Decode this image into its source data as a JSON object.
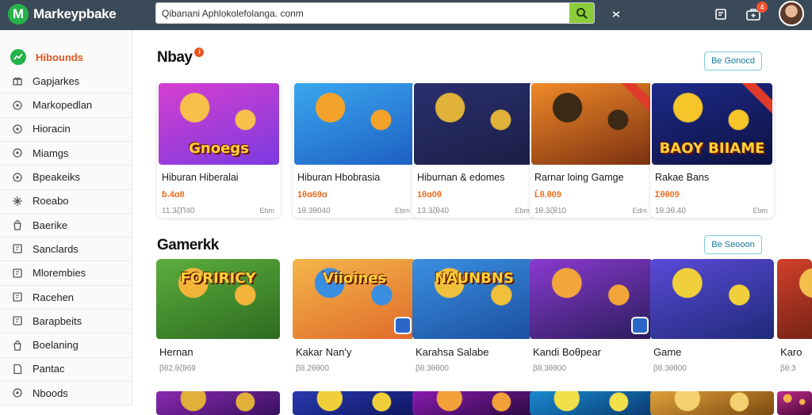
{
  "app": {
    "name": "Markeypbake",
    "logo_letter": "M"
  },
  "search": {
    "value": "Qibanani Aphlokolefolanga. conm",
    "placeholder": ""
  },
  "toolbar": {
    "cart_badge": "4"
  },
  "sidebar": {
    "items": [
      {
        "label": "Hibounds",
        "icon": "trend-icon"
      },
      {
        "label": "Gapjarkes",
        "icon": "gift-icon"
      },
      {
        "label": "Markopedlan",
        "icon": "circle-icon"
      },
      {
        "label": "Hioracin",
        "icon": "circle-icon"
      },
      {
        "label": "Miamgs",
        "icon": "circle-icon"
      },
      {
        "label": "Bpeakeiks",
        "icon": "circle-icon"
      },
      {
        "label": "Roeabo",
        "icon": "star-icon"
      },
      {
        "label": "Baerike",
        "icon": "bag-icon"
      },
      {
        "label": "Sanclards",
        "icon": "square-icon"
      },
      {
        "label": "Mlorembies",
        "icon": "square-icon"
      },
      {
        "label": "Racehen",
        "icon": "square-icon"
      },
      {
        "label": "Barapbeits",
        "icon": "square-icon"
      },
      {
        "label": "Boelaning",
        "icon": "bag-icon"
      },
      {
        "label": "Pantac",
        "icon": "page-icon"
      },
      {
        "label": "Nboods",
        "icon": "circle-icon"
      }
    ]
  },
  "sections": [
    {
      "title": "Nbay",
      "see_all": "Be Gonocd",
      "cards": [
        {
          "title": "Hiburan Hiberalai",
          "price": "ɓ.4ɑ8",
          "meta": "11.3ζΠ40",
          "rate": "Ebm",
          "thumb_text": "Gnoegs",
          "colors": [
            "#d63fcf",
            "#7a3ae0",
            "#f7c04a"
          ]
        },
        {
          "title": "Hiburan Hbobrasia",
          "price": "1θɑ69ɑ",
          "meta": "1θ.3θ040",
          "rate": "Ebrn",
          "thumb_text": "",
          "colors": [
            "#3aa7ee",
            "#1e5fc4",
            "#f5a22a"
          ]
        },
        {
          "title": "Hiburnan & edomes",
          "price": "1θɑ0θ",
          "meta": "13.3ζθ40",
          "rate": "Ebm",
          "thumb_text": "",
          "colors": [
            "#2a2f6f",
            "#1b1f44",
            "#e0b23a"
          ]
        },
        {
          "title": "Rarnar loing Gamge",
          "price": "Ĺθ.θ09",
          "meta": "1θ.3ζθ10",
          "rate": "Edm",
          "thumb_text": "",
          "colors": [
            "#f08a2a",
            "#7a3010",
            "#3b2a14"
          ]
        },
        {
          "title": "Rakae Bans",
          "price": "Σθθ09",
          "meta": "1θ.3θ.40",
          "rate": "Ebm",
          "thumb_text": "BAOY BIIAME",
          "colors": [
            "#1e2a8a",
            "#0c1240",
            "#f5c52a"
          ]
        }
      ]
    },
    {
      "title": "Gamerkk",
      "see_all": "Be Seooon",
      "cards": [
        {
          "title": "Hernan",
          "meta": "βθ2.θζθ69",
          "thumb_text": "FORIRICY",
          "colors": [
            "#5cae3e",
            "#2d6b1f",
            "#f2b53a"
          ]
        },
        {
          "title": "Kakar Nan'y",
          "meta": "βθ.2θθ00",
          "thumb_text": "Viioines",
          "colors": [
            "#f4b64a",
            "#e06a2a",
            "#3a8ee0"
          ]
        },
        {
          "title": "Karahsa Salabe",
          "meta": "βθ.3θθ00",
          "thumb_text": "NAUNBNS",
          "colors": [
            "#3b8fe0",
            "#1b4fa0",
            "#f0c03a"
          ]
        },
        {
          "title": "Kandi Boθpear",
          "meta": "βθ.3θθ00",
          "thumb_text": "",
          "colors": [
            "#8a3ad0",
            "#2a1c5a",
            "#f2a53a"
          ]
        },
        {
          "title": "Game",
          "meta": "βθ.3θθ00",
          "thumb_text": "",
          "colors": [
            "#5a4ad8",
            "#1f2a78",
            "#f0d03a"
          ]
        },
        {
          "title": "Karo",
          "meta": "βθ.3",
          "thumb_text": "",
          "colors": [
            "#d0402a",
            "#5a1a10",
            "#f2c04a"
          ]
        }
      ]
    },
    {
      "cards": [
        {
          "colors": [
            "#8a2ab0",
            "#3a1060",
            "#e0b03a"
          ]
        },
        {
          "colors": [
            "#2a3ab0",
            "#0e1660",
            "#f0d03a"
          ]
        },
        {
          "colors": [
            "#8a1ab0",
            "#2a0a40",
            "#f2a03a"
          ]
        },
        {
          "colors": [
            "#1a8ad0",
            "#0a3a70",
            "#f0e04a"
          ]
        },
        {
          "colors": [
            "#e0a03a",
            "#7a4a10",
            "#f5d070"
          ]
        },
        {
          "colors": [
            "#c02a8a",
            "#4a0a3a",
            "#f2b04a"
          ]
        }
      ]
    }
  ]
}
